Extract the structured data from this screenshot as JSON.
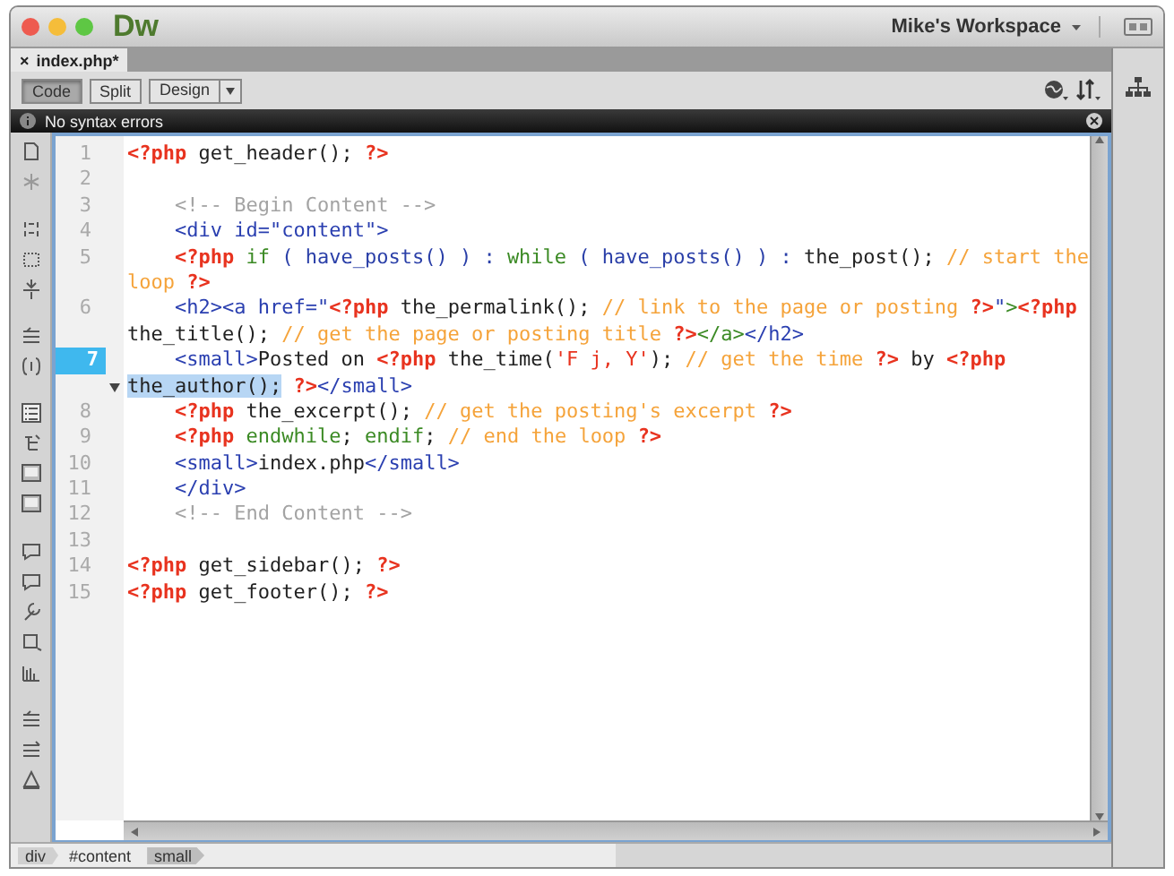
{
  "window": {
    "logo": "Dw",
    "workspace": "Mike's Workspace"
  },
  "document_tab": {
    "close": "×",
    "title": "index.php*"
  },
  "view_buttons": [
    {
      "label": "Code",
      "selected": true
    },
    {
      "label": "Split",
      "selected": false
    },
    {
      "label": "Design",
      "selected": false
    }
  ],
  "syntax_bar": {
    "message": "No syntax errors"
  },
  "code_lines": [
    {
      "number": "1",
      "current": false,
      "rows": [
        {
          "indented": false,
          "segments": [
            {
              "kind": "php",
              "text": "<?php"
            },
            {
              "kind": "plain",
              "text": " get_header(); "
            },
            {
              "kind": "php",
              "text": "?>"
            }
          ]
        }
      ]
    },
    {
      "number": "2",
      "current": false
    },
    {
      "number": "3",
      "current": false,
      "rows": [
        {
          "indented": true,
          "segments": [
            {
              "kind": "htmlcomment",
              "text": "<!-- Begin Content -->"
            }
          ]
        }
      ]
    },
    {
      "number": "4",
      "current": false,
      "rows": [
        {
          "indented": true,
          "segments": [
            {
              "kind": "tag",
              "text": "<div id=\"content\">"
            }
          ]
        }
      ]
    },
    {
      "number": "5",
      "current": false,
      "rows": [
        {
          "indented": true,
          "segments": [
            {
              "kind": "php",
              "text": "<?php"
            },
            {
              "kind": "keyword",
              "text": " if"
            },
            {
              "kind": "function",
              "text": " ( have_posts() ) : "
            },
            {
              "kind": "keyword",
              "text": "while"
            },
            {
              "kind": "function",
              "text": " ( have_posts() ) : "
            },
            {
              "kind": "plain",
              "text": "the_post(); "
            },
            {
              "kind": "comment",
              "text": "// start the"
            }
          ]
        },
        {
          "indented": false,
          "segments": [
            {
              "kind": "comment",
              "text": "loop "
            },
            {
              "kind": "php",
              "text": "?>"
            }
          ]
        }
      ]
    },
    {
      "number": "6",
      "current": false,
      "rows": [
        {
          "indented": true,
          "segments": [
            {
              "kind": "tag",
              "text": "<h2><a href=\""
            },
            {
              "kind": "php",
              "text": "<?php"
            },
            {
              "kind": "plain",
              "text": " the_permalink(); "
            },
            {
              "kind": "comment",
              "text": "// link to the page or posting "
            },
            {
              "kind": "php",
              "text": "?>"
            },
            {
              "kind": "tag",
              "text": "\""
            },
            {
              "kind": "link",
              "text": ">"
            },
            {
              "kind": "php",
              "text": "<?php"
            }
          ]
        },
        {
          "indented": false,
          "segments": [
            {
              "kind": "plain",
              "text": "the_title(); "
            },
            {
              "kind": "comment",
              "text": "// get the page or posting title "
            },
            {
              "kind": "php",
              "text": "?>"
            },
            {
              "kind": "link",
              "text": "</a>"
            },
            {
              "kind": "tag",
              "text": "</h2>"
            }
          ]
        }
      ]
    },
    {
      "number": "7",
      "current": true,
      "collapsible": true,
      "rows": [
        {
          "indented": true,
          "segments": [
            {
              "kind": "tag",
              "text": "<small>"
            },
            {
              "kind": "plain",
              "text": "Posted on "
            },
            {
              "kind": "php",
              "text": "<?php"
            },
            {
              "kind": "plain",
              "text": " the_time("
            },
            {
              "kind": "string",
              "text": "'F j, Y'"
            },
            {
              "kind": "plain",
              "text": "); "
            },
            {
              "kind": "comment",
              "text": "// get the time "
            },
            {
              "kind": "php",
              "text": "?>"
            },
            {
              "kind": "plain",
              "text": " by "
            },
            {
              "kind": "php",
              "text": "<?php"
            }
          ]
        },
        {
          "indented": false,
          "segments": [
            {
              "kind": "plain",
              "text": "the_author();",
              "highlighted": true
            },
            {
              "kind": "php",
              "text": " ?>"
            },
            {
              "kind": "tag",
              "text": "</small>"
            }
          ]
        }
      ]
    },
    {
      "number": "8",
      "current": false,
      "rows": [
        {
          "indented": true,
          "segments": [
            {
              "kind": "php",
              "text": "<?php"
            },
            {
              "kind": "plain",
              "text": " the_excerpt(); "
            },
            {
              "kind": "comment",
              "text": "// get the posting's excerpt "
            },
            {
              "kind": "php",
              "text": "?>"
            }
          ]
        }
      ]
    },
    {
      "number": "9",
      "current": false,
      "rows": [
        {
          "indented": true,
          "segments": [
            {
              "kind": "php",
              "text": "<?php"
            },
            {
              "kind": "keyword",
              "text": " endwhile"
            },
            {
              "kind": "plain",
              "text": "; "
            },
            {
              "kind": "keyword",
              "text": "endif"
            },
            {
              "kind": "plain",
              "text": "; "
            },
            {
              "kind": "comment",
              "text": "// end the loop "
            },
            {
              "kind": "php",
              "text": "?>"
            }
          ]
        }
      ]
    },
    {
      "number": "10",
      "current": false,
      "rows": [
        {
          "indented": true,
          "segments": [
            {
              "kind": "tag",
              "text": "<small>"
            },
            {
              "kind": "plain",
              "text": "index.php"
            },
            {
              "kind": "tag",
              "text": "</small>"
            }
          ]
        }
      ]
    },
    {
      "number": "11",
      "current": false,
      "rows": [
        {
          "indented": true,
          "segments": [
            {
              "kind": "tag",
              "text": "</div>"
            }
          ]
        }
      ]
    },
    {
      "number": "12",
      "current": false,
      "rows": [
        {
          "indented": true,
          "segments": [
            {
              "kind": "htmlcomment",
              "text": "<!-- End Content -->"
            }
          ]
        }
      ]
    },
    {
      "number": "13",
      "current": false
    },
    {
      "number": "14",
      "current": false,
      "rows": [
        {
          "indented": false,
          "segments": [
            {
              "kind": "php",
              "text": "<?php"
            },
            {
              "kind": "plain",
              "text": " get_sidebar(); "
            },
            {
              "kind": "php",
              "text": "?>"
            }
          ]
        }
      ]
    },
    {
      "number": "15",
      "current": false,
      "rows": [
        {
          "indented": false,
          "segments": [
            {
              "kind": "php",
              "text": "<?php"
            },
            {
              "kind": "plain",
              "text": " get_footer(); "
            },
            {
              "kind": "php",
              "text": "?>"
            }
          ]
        }
      ]
    }
  ],
  "tag_selector": [
    {
      "label": "div",
      "selected": false
    },
    {
      "label": "#content",
      "selected": false
    },
    {
      "label": "small",
      "selected": true
    }
  ]
}
